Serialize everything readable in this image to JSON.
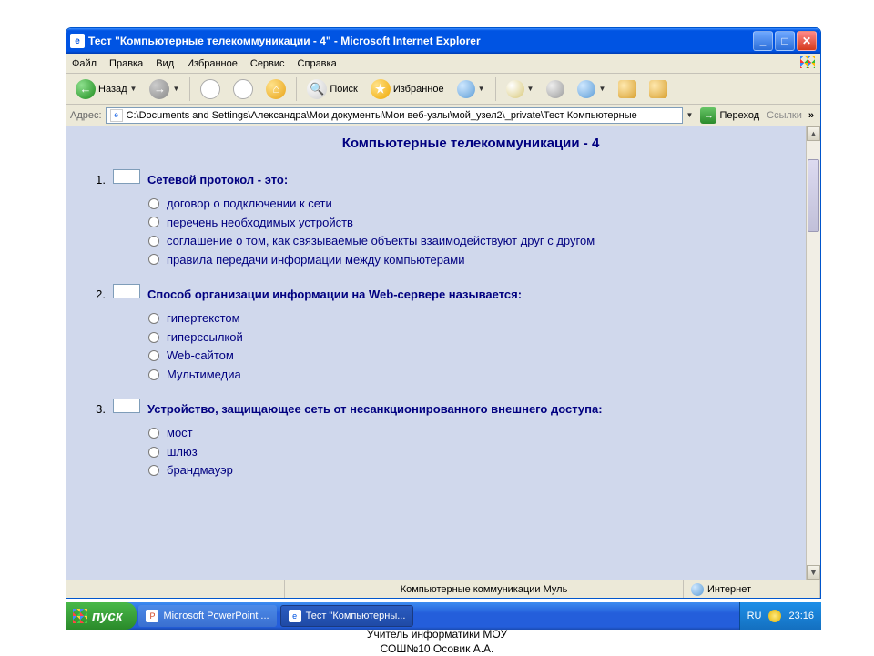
{
  "window": {
    "title": "Тест \"Компьютерные телекоммуникации - 4\" - Microsoft Internet Explorer"
  },
  "menu": {
    "file": "Файл",
    "edit": "Правка",
    "view": "Вид",
    "favorites": "Избранное",
    "tools": "Сервис",
    "help": "Справка"
  },
  "toolbar": {
    "back": "Назад",
    "search": "Поиск",
    "favorites": "Избранное"
  },
  "address": {
    "label": "Адрес:",
    "value": "C:\\Documents and Settings\\Александра\\Мои документы\\Мои веб-узлы\\мой_узел2\\_private\\Тест Компьютерные",
    "go": "Переход",
    "links": "Ссылки"
  },
  "page": {
    "title": "Компьютерные телекоммуникации - 4",
    "questions": [
      {
        "num": "1.",
        "text": "Сетевой протокол - это:",
        "options": [
          "договор о подключении к сети",
          "перечень необходимых устройств",
          "соглашение о том, как связываемые объекты взаимодействуют друг с другом",
          "правила передачи информации между компьютерами"
        ]
      },
      {
        "num": "2.",
        "text": "Способ организации информации на  Web-сервере называется:",
        "options": [
          "гипертекстом",
          "гиперссылкой",
          "Web-сайтом",
          "Мультимедиа"
        ]
      },
      {
        "num": "3.",
        "text": "Устройство, защищающее сеть от несанкционированного внешнего доступа:",
        "options": [
          "мост",
          "шлюз",
          "брандмауэр"
        ]
      }
    ]
  },
  "status": {
    "center": "Компьютерные коммуникации Муль",
    "zone": "Интернет"
  },
  "taskbar": {
    "start": "пуск",
    "items": [
      "Microsoft PowerPoint ...",
      "Тест \"Компьютерны..."
    ],
    "lang": "RU",
    "time": "23:16"
  },
  "caption": {
    "line1": "Учитель информатики МОУ",
    "line2": "СОШ№10 Осовик А.А."
  }
}
